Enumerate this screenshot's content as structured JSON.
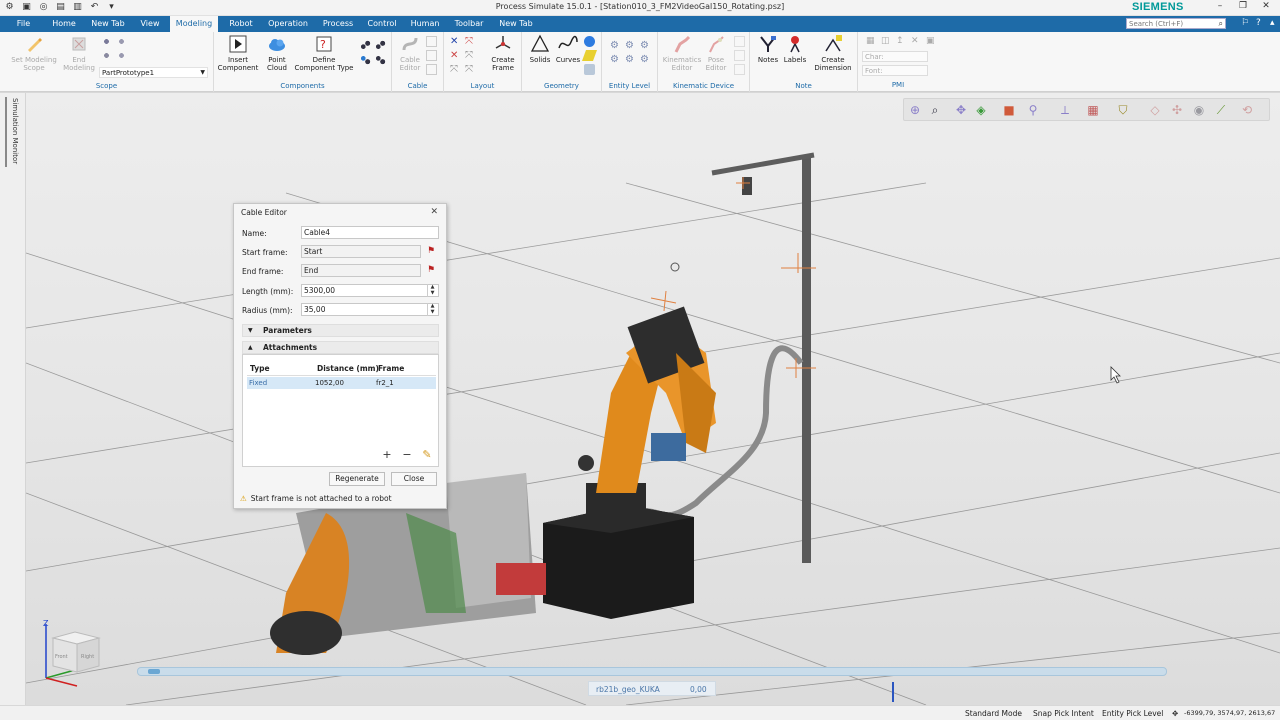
{
  "app": {
    "title": "Process Simulate 15.0.1 - [Station010_3_FM2VideoGal150_Rotating.psz]",
    "brand": "SIEMENS",
    "brand_color": "#009999"
  },
  "tabs": [
    "File",
    "Home",
    "New Tab",
    "View",
    "Modeling",
    "Robot",
    "Operation",
    "Process",
    "Control",
    "Human",
    "Toolbar",
    "New Tab"
  ],
  "active_tab": "Modeling",
  "search": {
    "placeholder": "Search (Ctrl+F)"
  },
  "ribbon": {
    "scope": {
      "label": "Scope",
      "set_modeling_scope": "Set Modeling Scope",
      "end_modeling": "End Modeling",
      "part_value": "PartPrototype1"
    },
    "components": {
      "label": "Components",
      "insert_component": "Insert Component",
      "point_cloud": "Point Cloud",
      "define_component_type": "Define Component Type"
    },
    "cable": {
      "label": "Cable",
      "cable_editor": "Cable Editor"
    },
    "layout": {
      "label": "Layout",
      "create_frame": "Create Frame"
    },
    "geometry": {
      "label": "Geometry",
      "solids": "Solids",
      "curves": "Curves"
    },
    "entity_level": {
      "label": "Entity Level"
    },
    "kinematic_device": {
      "label": "Kinematic Device",
      "kinematics_editor": "Kinematics Editor",
      "pose_editor": "Pose Editor"
    },
    "note": {
      "label": "Note",
      "notes": "Notes",
      "labels": "Labels",
      "create_dimension": "Create Dimension"
    },
    "pmi": {
      "label": "PMI",
      "char_placeholder": "Char:",
      "font_placeholder": "Font:"
    }
  },
  "side_panel": {
    "label": "Simulation Monitor"
  },
  "cable_editor": {
    "title": "Cable Editor",
    "name_label": "Name:",
    "name_value": "Cable4",
    "start_frame_label": "Start frame:",
    "start_frame_value": "Start",
    "end_frame_label": "End frame:",
    "end_frame_value": "End",
    "length_label": "Length (mm):",
    "length_value": "5300,00",
    "radius_label": "Radius (mm):",
    "radius_value": "35,00",
    "parameters_label": "Parameters",
    "attachments_label": "Attachments",
    "columns": [
      "Type",
      "Distance (mm)",
      "Frame"
    ],
    "rows": [
      {
        "type": "Fixed",
        "distance": "1052,00",
        "frame": "fr2_1"
      }
    ],
    "regenerate_label": "Regenerate",
    "close_label": "Close",
    "warning": "Start frame is not attached to a robot"
  },
  "navcube": {
    "left_face": "Front",
    "right_face": "Right",
    "axis_z": "Z",
    "axis_y": "Y"
  },
  "simulation": {
    "name": "rb21b_geo_KUKA",
    "value": "0,00",
    "progress": 0.01
  },
  "status_bar": {
    "mode": "Standard Mode",
    "pick_intent": "Snap Pick Intent",
    "pick_level": "Entity Pick Level",
    "coordinates": "-6399,79, 3574,97, 2613,67"
  }
}
